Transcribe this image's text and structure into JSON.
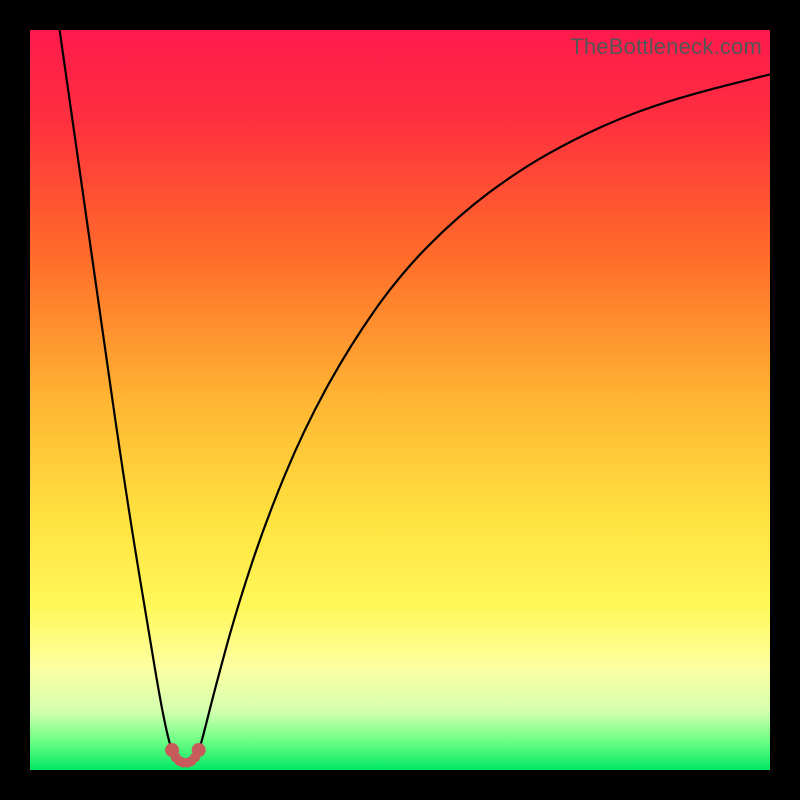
{
  "watermark": "TheBottleneck.com",
  "chart_data": {
    "type": "line",
    "title": "",
    "xlabel": "",
    "ylabel": "",
    "xlim": [
      0,
      100
    ],
    "ylim": [
      0,
      100
    ],
    "gradient_stops": [
      {
        "pos": 0.0,
        "color": "#ff1a4d"
      },
      {
        "pos": 0.12,
        "color": "#ff2f3f"
      },
      {
        "pos": 0.3,
        "color": "#ff6a2a"
      },
      {
        "pos": 0.5,
        "color": "#ffb533"
      },
      {
        "pos": 0.66,
        "color": "#ffe23f"
      },
      {
        "pos": 0.78,
        "color": "#fff85a"
      },
      {
        "pos": 0.86,
        "color": "#fdffa0"
      },
      {
        "pos": 0.92,
        "color": "#d4ffb0"
      },
      {
        "pos": 0.96,
        "color": "#6fff86"
      },
      {
        "pos": 1.0,
        "color": "#00e865"
      }
    ],
    "series": [
      {
        "name": "bottleneck-curve",
        "color": "#000000",
        "width": 2.2,
        "points": [
          {
            "x": 4.0,
            "y": 100.0
          },
          {
            "x": 6.0,
            "y": 86.0
          },
          {
            "x": 8.0,
            "y": 72.0
          },
          {
            "x": 10.0,
            "y": 58.0
          },
          {
            "x": 12.0,
            "y": 44.0
          },
          {
            "x": 14.0,
            "y": 31.0
          },
          {
            "x": 16.0,
            "y": 19.0
          },
          {
            "x": 17.5,
            "y": 10.0
          },
          {
            "x": 18.5,
            "y": 5.0
          },
          {
            "x": 19.2,
            "y": 2.5
          },
          {
            "x": 19.8,
            "y": 1.4
          },
          {
            "x": 20.4,
            "y": 1.0
          },
          {
            "x": 21.0,
            "y": 1.0
          },
          {
            "x": 21.6,
            "y": 1.0
          },
          {
            "x": 22.2,
            "y": 1.4
          },
          {
            "x": 22.8,
            "y": 2.5
          },
          {
            "x": 23.5,
            "y": 5.0
          },
          {
            "x": 25.0,
            "y": 11.0
          },
          {
            "x": 28.0,
            "y": 22.0
          },
          {
            "x": 32.0,
            "y": 34.0
          },
          {
            "x": 37.0,
            "y": 46.0
          },
          {
            "x": 43.0,
            "y": 57.0
          },
          {
            "x": 50.0,
            "y": 67.0
          },
          {
            "x": 58.0,
            "y": 75.0
          },
          {
            "x": 66.0,
            "y": 81.0
          },
          {
            "x": 74.0,
            "y": 85.5
          },
          {
            "x": 82.0,
            "y": 89.0
          },
          {
            "x": 90.0,
            "y": 91.5
          },
          {
            "x": 100.0,
            "y": 94.0
          }
        ]
      }
    ],
    "markers": {
      "color": "#c75a5a",
      "radius_large": 7,
      "radius_small": 5,
      "points": [
        {
          "x": 19.2,
          "y": 2.7,
          "r": "large"
        },
        {
          "x": 19.7,
          "y": 1.7,
          "r": "small"
        },
        {
          "x": 20.2,
          "y": 1.2,
          "r": "small"
        },
        {
          "x": 20.7,
          "y": 1.0,
          "r": "small"
        },
        {
          "x": 21.3,
          "y": 1.0,
          "r": "small"
        },
        {
          "x": 21.8,
          "y": 1.2,
          "r": "small"
        },
        {
          "x": 22.3,
          "y": 1.7,
          "r": "small"
        },
        {
          "x": 22.8,
          "y": 2.7,
          "r": "large"
        }
      ]
    }
  }
}
